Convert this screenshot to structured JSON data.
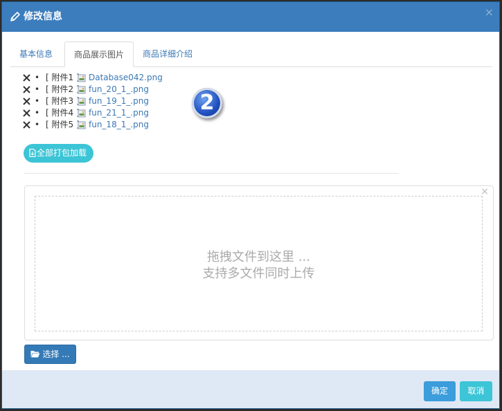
{
  "modal": {
    "title": "修改信息",
    "icon": "pencil-icon",
    "close_glyph": "×"
  },
  "tabs": [
    {
      "label": "基本信息",
      "active": false
    },
    {
      "label": "商品展示图片",
      "active": true
    },
    {
      "label": "商品详细介绍",
      "active": false
    }
  ],
  "attachments": [
    {
      "label": "[ 附件1 ]",
      "name": "Database042.png"
    },
    {
      "label": "[ 附件2 ]",
      "name": "fun_20_1_.png"
    },
    {
      "label": "[ 附件3 ]",
      "name": "fun_19_1_.png"
    },
    {
      "label": "[ 附件4 ]",
      "name": "fun_21_1_.png"
    },
    {
      "label": "[ 附件5 ]",
      "name": "fun_18_1_.png"
    }
  ],
  "bullet": "•",
  "step_badge": "2",
  "download_all_label": "全部打包加载",
  "upload": {
    "close_glyph": "×",
    "drop_line1": "拖拽文件到这里 ...",
    "drop_line2": "支持多文件同时上传",
    "choose_label": "选择 ..."
  },
  "footer": {
    "confirm_label": "确定",
    "cancel_label": "取消"
  },
  "colors": {
    "header": "#3c7dbd",
    "link": "#3a78b5",
    "teal": "#3cc5d6",
    "primary": "#337ab7",
    "confirm": "#3b9ddb",
    "footer_bg": "#dfe8f5"
  }
}
